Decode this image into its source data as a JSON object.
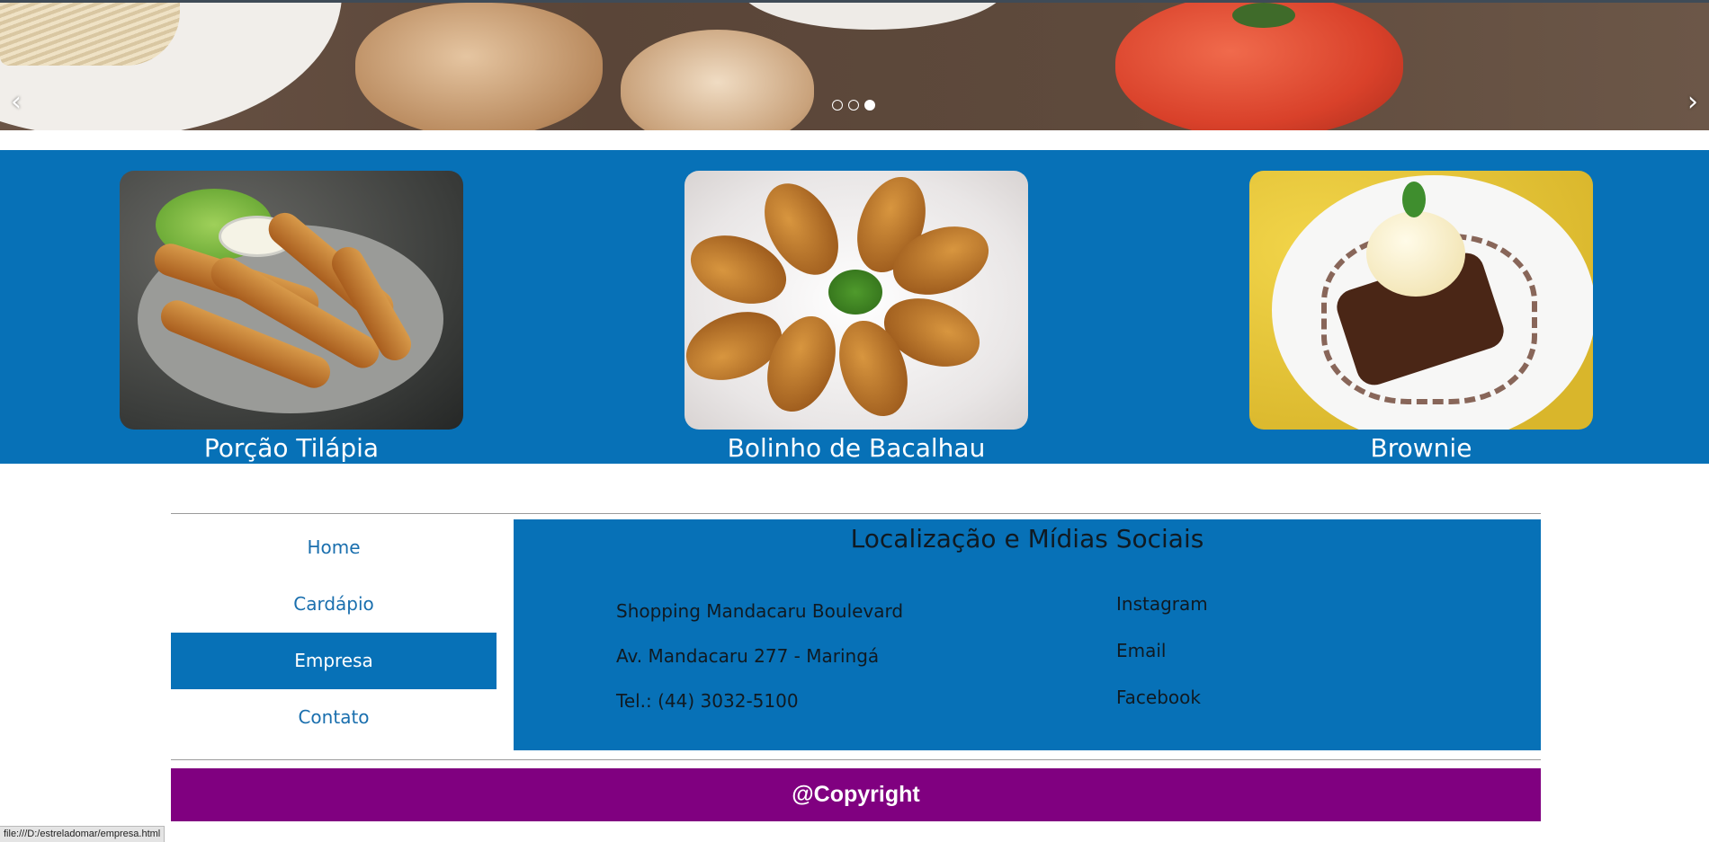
{
  "carousel": {
    "prev_icon": "‹",
    "next_icon": "›",
    "slides_total": 3,
    "active_slide": 3
  },
  "dishes": [
    {
      "name": "Porção Tilápia"
    },
    {
      "name": "Bolinho de Bacalhau"
    },
    {
      "name": "Brownie"
    }
  ],
  "nav": {
    "items": [
      {
        "label": "Home"
      },
      {
        "label": "Cardápio"
      },
      {
        "label": "Empresa"
      },
      {
        "label": "Contato"
      }
    ],
    "active": "Empresa"
  },
  "info": {
    "title": "Localização e Mídias Sociais",
    "address": [
      "Shopping Mandacaru Boulevard",
      "Av. Mandacaru 277 - Maringá",
      "Tel.: (44) 3032-5100"
    ],
    "social": [
      "Instagram",
      "Email",
      "Facebook"
    ]
  },
  "footer": {
    "text": "@Copyright"
  },
  "status_url": "file:///D:/estreladomar/empresa.html",
  "colors": {
    "primary": "#0771b7",
    "footer": "#800080"
  }
}
